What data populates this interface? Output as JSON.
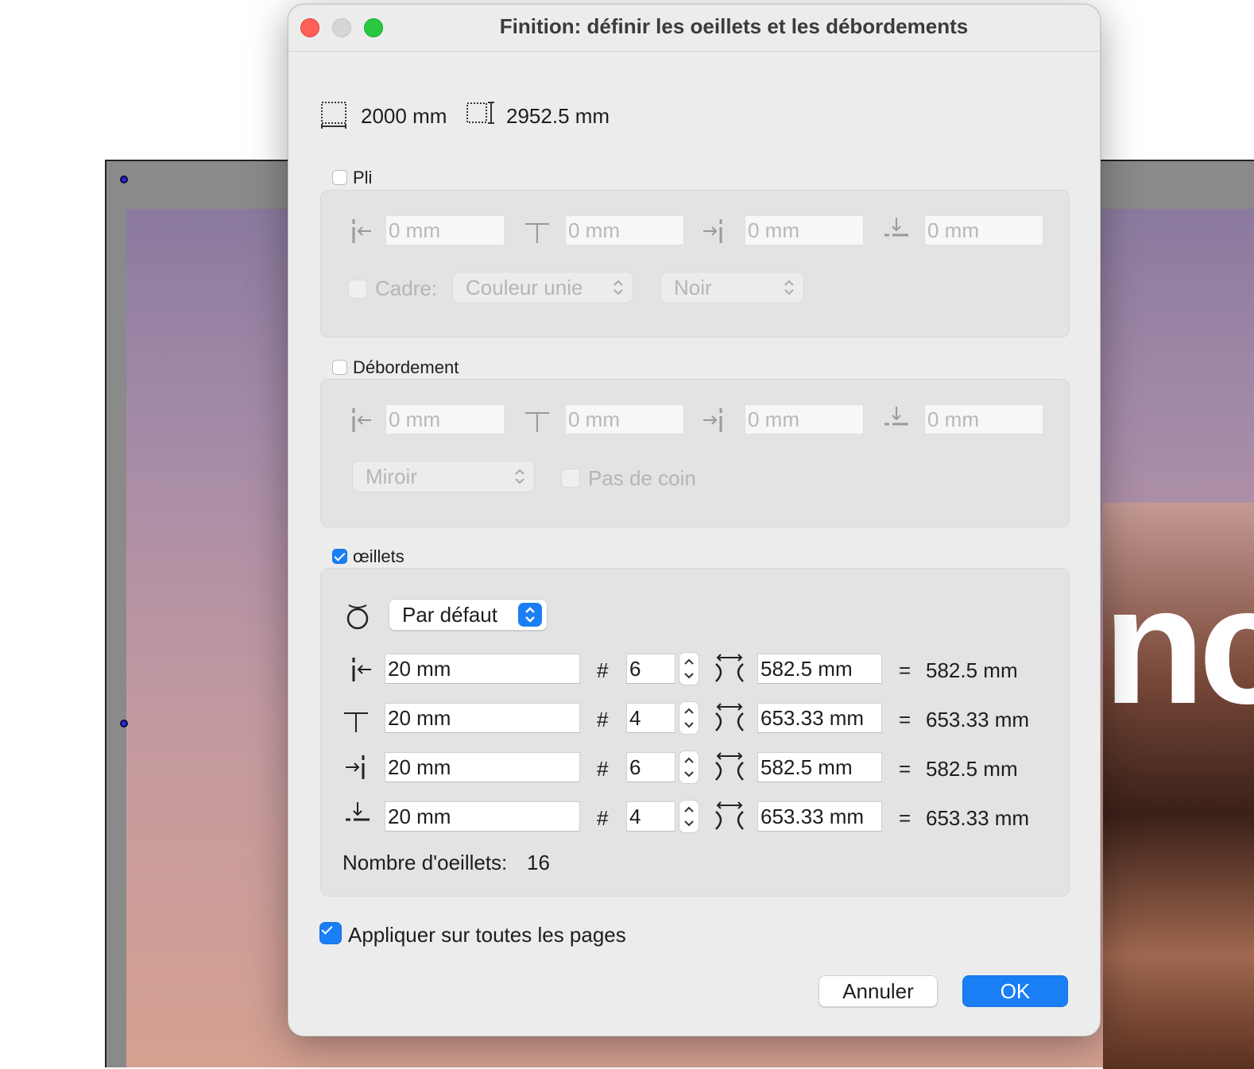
{
  "dialog": {
    "title": "Finition: définir les oeillets et les débordements"
  },
  "dimensions": {
    "width": "2000 mm",
    "height": "2952.5 mm"
  },
  "pli": {
    "label": "Pli",
    "checked": false,
    "fields": [
      {
        "value": "0 mm",
        "icon": "left-margin-icon"
      },
      {
        "value": "0 mm",
        "icon": "top-margin-icon"
      },
      {
        "value": "0 mm",
        "icon": "right-margin-icon"
      },
      {
        "value": "0 mm",
        "icon": "bottom-margin-icon"
      }
    ],
    "cadre_label": "Cadre:",
    "cadre_fill": "Couleur unie",
    "cadre_color": "Noir"
  },
  "debordement": {
    "label": "Débordement",
    "checked": false,
    "fields": [
      {
        "value": "0 mm",
        "icon": "left-margin-icon"
      },
      {
        "value": "0 mm",
        "icon": "top-margin-icon"
      },
      {
        "value": "0 mm",
        "icon": "right-margin-icon"
      },
      {
        "value": "0 mm",
        "icon": "bottom-margin-icon"
      }
    ],
    "mode": "Miroir",
    "no_corner_label": "Pas de coin"
  },
  "oeillets": {
    "label": "œillets",
    "checked": true,
    "style": "Par défaut",
    "rows": [
      {
        "offset": "20 mm",
        "count": "6",
        "spacing": "582.5 mm",
        "result": "582.5 mm",
        "icon": "left-margin-icon"
      },
      {
        "offset": "20 mm",
        "count": "4",
        "spacing": "653.33 mm",
        "result": "653.33 mm",
        "icon": "top-margin-icon"
      },
      {
        "offset": "20 mm",
        "count": "6",
        "spacing": "582.5 mm",
        "result": "582.5 mm",
        "icon": "right-margin-icon"
      },
      {
        "offset": "20 mm",
        "count": "4",
        "spacing": "653.33 mm",
        "result": "653.33 mm",
        "icon": "bottom-margin-icon"
      }
    ],
    "hash": "#",
    "equals": "=",
    "total_label": "Nombre d'oeillets:",
    "total_value": "16"
  },
  "apply_all": {
    "label": "Appliquer sur toutes les pages",
    "checked": true
  },
  "buttons": {
    "cancel": "Annuler",
    "ok": "OK"
  },
  "colors": {
    "accent": "#1a7ef5",
    "close": "#ff5f57",
    "zoom": "#28c840"
  }
}
